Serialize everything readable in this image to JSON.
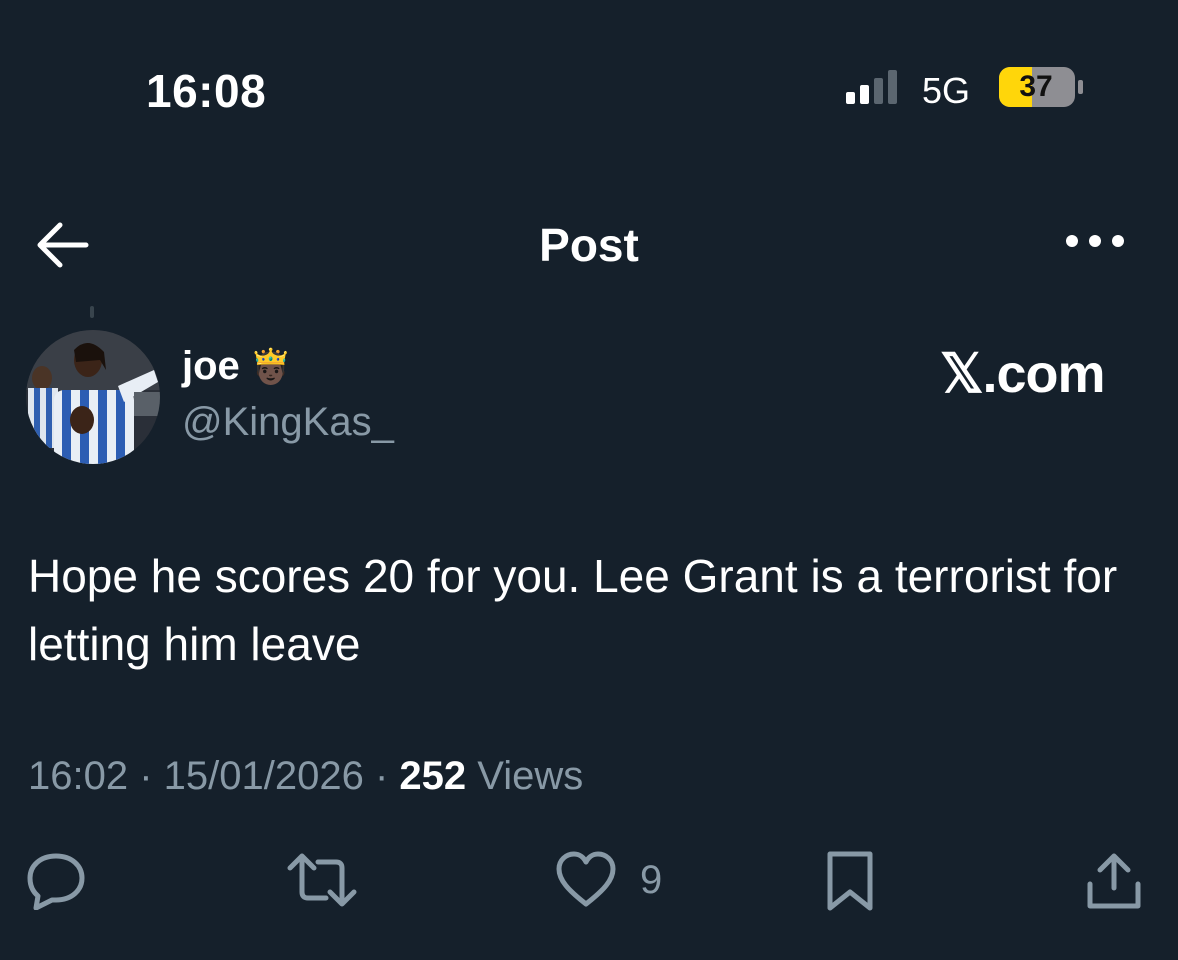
{
  "status_bar": {
    "time": "16:08",
    "network": "5G",
    "battery": "37",
    "signal_icon": "cellular-signal-icon",
    "battery_icon": "battery-icon"
  },
  "header": {
    "title": "Post",
    "back_icon": "back-arrow-icon",
    "more_icon": "more-options-icon"
  },
  "author": {
    "name": "joe",
    "name_emoji": "🤴🏿",
    "handle": "@KingKas_"
  },
  "watermark": "𝕏.com",
  "post": {
    "text": "Hope he scores 20 for you. Lee Grant is a terrorist for letting him leave",
    "time": "16:02",
    "separator": " · ",
    "date": "15/01/2026",
    "views_count": "252",
    "views_label": "Views"
  },
  "actions": {
    "like_count": "9",
    "icons": [
      "reply-icon",
      "retweet-icon",
      "like-icon",
      "bookmark-icon",
      "share-icon"
    ]
  },
  "colors": {
    "background": "#15202b",
    "secondary_text": "#8899a6",
    "battery_fill": "#ffd60a"
  }
}
